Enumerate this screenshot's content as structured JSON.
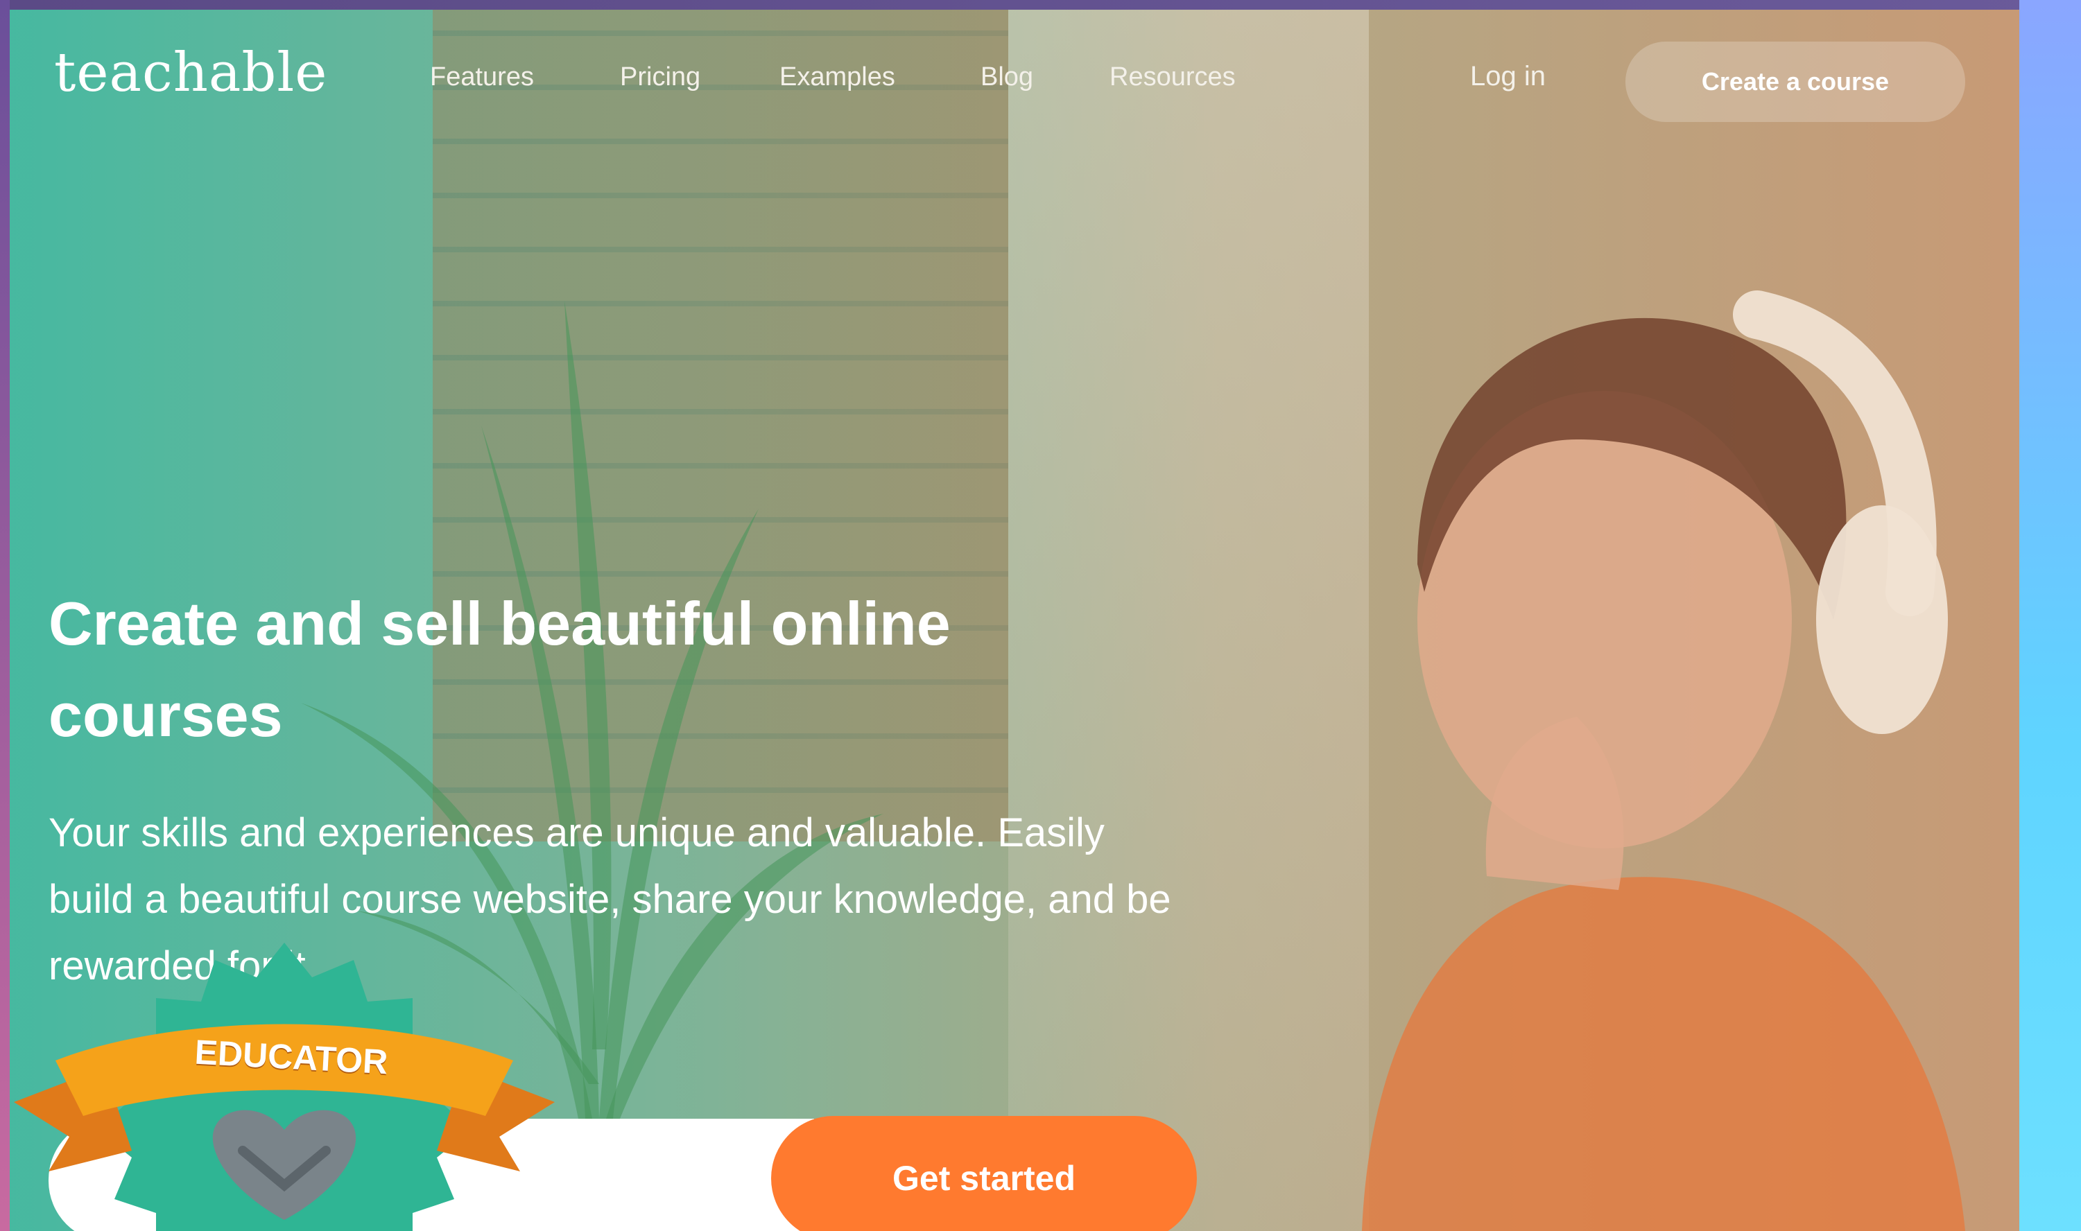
{
  "brand": {
    "logo_text": "teachable",
    "accent_color": "#ff7a2f",
    "teal_color": "#3bbca4"
  },
  "nav": {
    "links": [
      "Features",
      "Pricing",
      "Examples",
      "Blog",
      "Resources"
    ],
    "login_label": "Log in",
    "cta_label": "Create a course"
  },
  "hero": {
    "headline": "Create and sell beautiful online courses",
    "subtext": "Your skills and experiences are unique and valuable. Easily build a beautiful course website, share your knowledge, and be rewarded for it",
    "email_placeholder": "",
    "cta_label": "Get started"
  },
  "badge": {
    "label": "EDUCATOR",
    "icon": "handshake-icon"
  }
}
